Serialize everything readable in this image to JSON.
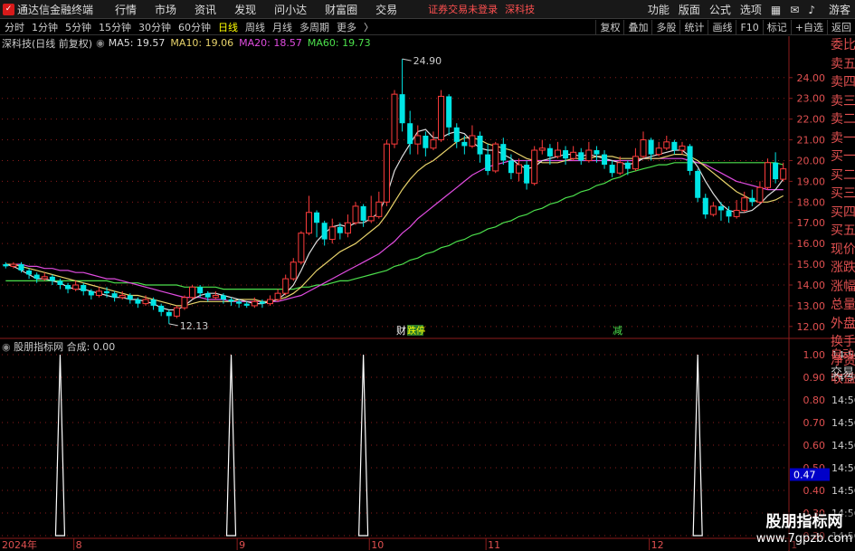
{
  "app": {
    "logo": "logo-icon",
    "title": "通达信金融终端",
    "menu": [
      "行情",
      "市场",
      "资讯",
      "发现",
      "问小达",
      "财富圈",
      "交易"
    ],
    "notice": "证券交易未登录",
    "stock": "深科技",
    "right_menu": [
      "功能",
      "版面",
      "公式",
      "选项"
    ],
    "guest": "游客"
  },
  "toolbar": {
    "periods": [
      "分时",
      "1分钟",
      "5分钟",
      "15分钟",
      "30分钟",
      "60分钟",
      "日线",
      "周线",
      "月线",
      "多周期",
      "更多"
    ],
    "active": "日线",
    "tools": [
      "复权",
      "叠加",
      "多股",
      "统计",
      "画线",
      "F10",
      "标记",
      "+自选",
      "返回"
    ]
  },
  "legend": {
    "name": "深科技(日线 前复权)",
    "ma5": "MA5: 19.57",
    "ma10": "MA10: 19.06",
    "ma20": "MA20: 18.57",
    "ma60": "MA60: 19.73"
  },
  "sidepanel": [
    "委比",
    "卖五",
    "卖四",
    "卖三",
    "卖二",
    "卖一",
    "买一",
    "买二",
    "买三",
    "买四",
    "买五",
    "现价",
    "涨跌",
    "涨幅",
    "总量",
    "外盘",
    "换手",
    "净资",
    "收益"
  ],
  "sub": {
    "name": "股朋指标网",
    "value": "合成: 0.00",
    "side": [
      "自动",
      "交易"
    ],
    "times": [
      "14:56",
      "14:56",
      "14:56",
      "14:56",
      "14:56",
      "14:56",
      "14:56",
      "14:56",
      "14:56"
    ]
  },
  "markers": {
    "cai": "财",
    "dieting": "跌停",
    "jian": "减"
  },
  "watermark": {
    "line1": "股朋指标网",
    "line2": "www.7gpzb.com"
  },
  "colors": {
    "up": "#ff3c3c",
    "down": "#00e5e5",
    "ma5": "#dddddd",
    "ma10": "#e8d36b",
    "ma20": "#e04ce0",
    "ma60": "#4ce04c",
    "grid": "#8b1c1c"
  },
  "chart_data": {
    "type": "candlestick",
    "price_axis": [
      24.0,
      23.0,
      22.0,
      21.0,
      20.0,
      19.0,
      18.0,
      17.0,
      16.0,
      15.0,
      14.0,
      13.0,
      12.0
    ],
    "ylim": [
      11.6,
      25.3
    ],
    "sub_axis": [
      1.0,
      0.9,
      0.8,
      0.7,
      0.6,
      0.5,
      0.4,
      0.3,
      0.2
    ],
    "sub_current": "0.47",
    "high_label": "24.90",
    "low_label": "12.13",
    "date_labels": [
      "2024年",
      "8",
      "9",
      "10",
      "11",
      "12",
      "1"
    ],
    "x_start_label": "2024年",
    "candles": [
      [
        15.0,
        14.9,
        15.1,
        14.8
      ],
      [
        14.9,
        15.0,
        15.1,
        14.8
      ],
      [
        15.0,
        14.7,
        15.1,
        14.6
      ],
      [
        14.7,
        14.5,
        14.8,
        14.3
      ],
      [
        14.5,
        14.3,
        14.6,
        14.1
      ],
      [
        14.3,
        14.4,
        14.6,
        14.2
      ],
      [
        14.4,
        14.2,
        14.5,
        14.0
      ],
      [
        14.2,
        14.0,
        14.3,
        13.8
      ],
      [
        14.0,
        13.8,
        14.1,
        13.6
      ],
      [
        13.8,
        14.0,
        14.2,
        13.7
      ],
      [
        14.0,
        13.7,
        14.1,
        13.5
      ],
      [
        13.7,
        13.5,
        13.8,
        13.3
      ],
      [
        13.5,
        13.7,
        13.9,
        13.4
      ],
      [
        13.7,
        13.6,
        13.9,
        13.4
      ],
      [
        13.6,
        13.4,
        13.7,
        13.2
      ],
      [
        13.4,
        13.5,
        13.7,
        13.3
      ],
      [
        13.5,
        13.3,
        13.6,
        13.1
      ],
      [
        13.3,
        13.1,
        13.4,
        12.9
      ],
      [
        13.1,
        13.3,
        13.5,
        13.0
      ],
      [
        13.3,
        13.0,
        13.4,
        12.8
      ],
      [
        13.0,
        12.7,
        13.1,
        12.5
      ],
      [
        12.7,
        12.5,
        12.8,
        12.13
      ],
      [
        12.5,
        12.9,
        13.0,
        12.4
      ],
      [
        12.9,
        13.4,
        13.5,
        12.8
      ],
      [
        13.4,
        13.9,
        14.0,
        13.3
      ],
      [
        13.9,
        13.6,
        14.0,
        13.4
      ],
      [
        13.6,
        13.4,
        13.7,
        13.2
      ],
      [
        13.4,
        13.5,
        13.7,
        13.3
      ],
      [
        13.5,
        13.3,
        13.6,
        13.1
      ],
      [
        13.3,
        13.2,
        13.4,
        13.0
      ],
      [
        13.2,
        13.1,
        13.3,
        12.9
      ],
      [
        13.1,
        13.0,
        13.2,
        12.9
      ],
      [
        13.0,
        13.2,
        13.4,
        12.9
      ],
      [
        13.2,
        13.1,
        13.3,
        12.9
      ],
      [
        13.1,
        13.3,
        13.5,
        13.0
      ],
      [
        13.3,
        13.6,
        13.8,
        13.2
      ],
      [
        13.6,
        14.3,
        14.5,
        13.5
      ],
      [
        14.3,
        15.1,
        15.3,
        14.2
      ],
      [
        15.1,
        16.5,
        16.6,
        15.0
      ],
      [
        16.5,
        17.5,
        18.3,
        16.4
      ],
      [
        17.5,
        17.0,
        17.6,
        16.3
      ],
      [
        17.0,
        16.2,
        17.1,
        15.9
      ],
      [
        16.2,
        16.8,
        17.2,
        16.0
      ],
      [
        16.8,
        16.5,
        17.0,
        16.2
      ],
      [
        16.5,
        17.0,
        17.4,
        16.3
      ],
      [
        17.0,
        17.8,
        18.0,
        16.9
      ],
      [
        17.8,
        17.1,
        17.9,
        16.8
      ],
      [
        17.1,
        17.3,
        18.3,
        17.0
      ],
      [
        17.3,
        18.0,
        18.5,
        17.2
      ],
      [
        18.0,
        20.8,
        21.0,
        17.8
      ],
      [
        20.8,
        23.2,
        23.4,
        20.6
      ],
      [
        23.2,
        21.8,
        24.9,
        21.4
      ],
      [
        21.8,
        20.8,
        22.4,
        20.3
      ],
      [
        20.8,
        21.2,
        21.7,
        20.3
      ],
      [
        21.2,
        20.6,
        21.4,
        20.2
      ],
      [
        20.6,
        21.0,
        21.4,
        20.5
      ],
      [
        21.0,
        23.1,
        23.4,
        20.9
      ],
      [
        23.1,
        21.6,
        23.2,
        21.2
      ],
      [
        21.6,
        20.9,
        21.8,
        20.6
      ],
      [
        20.9,
        20.7,
        21.2,
        20.3
      ],
      [
        20.7,
        21.2,
        21.7,
        20.6
      ],
      [
        21.2,
        20.3,
        21.4,
        19.9
      ],
      [
        20.3,
        19.5,
        20.8,
        19.3
      ],
      [
        19.5,
        20.8,
        20.9,
        19.4
      ],
      [
        20.8,
        20.0,
        21.1,
        19.8
      ],
      [
        20.0,
        19.4,
        20.3,
        19.1
      ],
      [
        19.4,
        19.8,
        20.1,
        19.0
      ],
      [
        19.8,
        18.9,
        20.0,
        18.6
      ],
      [
        18.9,
        20.5,
        20.7,
        18.8
      ],
      [
        20.5,
        20.6,
        21.0,
        20.3
      ],
      [
        20.6,
        20.2,
        20.8,
        19.8
      ],
      [
        20.2,
        20.5,
        20.9,
        20.1
      ],
      [
        20.5,
        20.1,
        20.7,
        19.8
      ],
      [
        20.1,
        20.4,
        20.7,
        20.0
      ],
      [
        20.4,
        20.0,
        20.6,
        19.8
      ],
      [
        20.0,
        20.5,
        20.9,
        19.9
      ],
      [
        20.5,
        20.3,
        20.7,
        19.9
      ],
      [
        20.3,
        19.8,
        20.5,
        19.6
      ],
      [
        19.8,
        19.4,
        20.0,
        19.2
      ],
      [
        19.4,
        19.9,
        20.2,
        19.3
      ],
      [
        19.9,
        19.6,
        20.0,
        19.3
      ],
      [
        19.6,
        20.2,
        20.6,
        19.5
      ],
      [
        20.2,
        21.0,
        21.4,
        20.1
      ],
      [
        21.0,
        20.3,
        21.1,
        20.0
      ],
      [
        20.3,
        20.6,
        20.9,
        20.2
      ],
      [
        20.6,
        20.9,
        21.2,
        20.5
      ],
      [
        20.9,
        20.5,
        21.0,
        20.3
      ],
      [
        20.5,
        20.7,
        20.9,
        20.3
      ],
      [
        20.7,
        19.5,
        20.8,
        19.3
      ],
      [
        19.5,
        18.2,
        19.6,
        18.0
      ],
      [
        18.2,
        17.4,
        18.4,
        17.2
      ],
      [
        17.4,
        17.8,
        18.0,
        17.3
      ],
      [
        17.8,
        17.6,
        18.0,
        17.1
      ],
      [
        17.6,
        17.3,
        17.8,
        17.0
      ],
      [
        17.3,
        17.6,
        18.1,
        17.2
      ],
      [
        17.6,
        18.2,
        18.5,
        17.5
      ],
      [
        18.2,
        18.0,
        18.6,
        17.8
      ],
      [
        18.0,
        18.7,
        19.0,
        17.9
      ],
      [
        18.7,
        19.9,
        20.1,
        18.6
      ],
      [
        19.9,
        19.1,
        20.4,
        18.9
      ],
      [
        19.1,
        19.6,
        19.9,
        19.0
      ]
    ],
    "ma5": [
      15.0,
      14.9,
      14.7,
      14.5,
      14.3,
      14.3,
      14.2,
      14.1,
      13.9,
      13.8,
      13.8,
      13.7,
      13.6,
      13.5,
      13.4,
      13.4,
      13.3,
      13.3,
      13.2,
      13.1,
      12.9,
      12.8,
      12.8,
      13.0,
      13.3,
      13.5,
      13.6,
      13.6,
      13.5,
      13.4,
      13.3,
      13.2,
      13.1,
      13.1,
      13.2,
      13.3,
      13.6,
      14.0,
      14.7,
      15.5,
      16.1,
      16.5,
      16.8,
      16.9,
      16.8,
      17.0,
      17.0,
      17.2,
      17.5,
      18.3,
      19.5,
      20.2,
      20.8,
      21.4,
      21.5,
      21.1,
      21.1,
      21.3,
      21.4,
      21.3,
      20.9,
      20.6,
      20.5,
      20.5,
      20.3,
      20.1,
      19.8,
      19.6,
      19.7,
      20.0,
      20.1,
      20.2,
      20.3,
      20.3,
      20.2,
      20.3,
      20.2,
      20.1,
      20.0,
      19.9,
      19.8,
      19.9,
      20.1,
      20.2,
      20.3,
      20.4,
      20.5,
      20.5,
      20.2,
      19.7,
      19.0,
      18.4,
      17.9,
      17.6,
      17.5,
      17.5,
      17.6,
      17.9,
      18.3,
      18.6,
      19.1
    ],
    "ma10": [
      15.0,
      15.0,
      14.9,
      14.8,
      14.7,
      14.6,
      14.5,
      14.4,
      14.3,
      14.2,
      14.1,
      14.0,
      13.9,
      13.8,
      13.7,
      13.6,
      13.5,
      13.5,
      13.4,
      13.3,
      13.2,
      13.1,
      13.0,
      13.0,
      13.1,
      13.2,
      13.2,
      13.2,
      13.2,
      13.2,
      13.3,
      13.3,
      13.3,
      13.2,
      13.2,
      13.3,
      13.4,
      13.6,
      13.9,
      14.3,
      14.7,
      15.0,
      15.3,
      15.6,
      15.8,
      16.0,
      16.3,
      16.6,
      16.9,
      17.4,
      18.0,
      18.6,
      19.1,
      19.5,
      19.8,
      20.0,
      20.3,
      20.6,
      20.9,
      21.1,
      21.1,
      21.0,
      20.8,
      20.7,
      20.6,
      20.5,
      20.3,
      20.1,
      20.0,
      19.9,
      19.9,
      19.9,
      20.0,
      20.1,
      20.1,
      20.1,
      20.2,
      20.2,
      20.2,
      20.1,
      20.1,
      20.1,
      20.1,
      20.1,
      20.1,
      20.2,
      20.3,
      20.3,
      20.2,
      20.0,
      19.7,
      19.4,
      19.1,
      18.8,
      18.5,
      18.3,
      18.1,
      18.0,
      18.0,
      18.1,
      18.3
    ],
    "ma20": [
      15.0,
      15.0,
      15.0,
      14.9,
      14.9,
      14.8,
      14.8,
      14.7,
      14.7,
      14.6,
      14.6,
      14.5,
      14.4,
      14.3,
      14.3,
      14.2,
      14.1,
      14.0,
      13.9,
      13.8,
      13.7,
      13.6,
      13.5,
      13.4,
      13.4,
      13.4,
      13.3,
      13.3,
      13.3,
      13.2,
      13.2,
      13.2,
      13.2,
      13.2,
      13.2,
      13.2,
      13.3,
      13.4,
      13.5,
      13.7,
      13.9,
      14.1,
      14.3,
      14.5,
      14.7,
      14.9,
      15.1,
      15.3,
      15.5,
      15.8,
      16.1,
      16.5,
      16.8,
      17.2,
      17.5,
      17.8,
      18.1,
      18.4,
      18.7,
      19.0,
      19.3,
      19.5,
      19.7,
      19.8,
      19.9,
      20.0,
      20.0,
      20.0,
      20.0,
      20.0,
      20.0,
      20.0,
      20.0,
      20.0,
      20.0,
      20.0,
      20.0,
      20.0,
      20.0,
      20.0,
      20.0,
      20.0,
      20.1,
      20.1,
      20.1,
      20.1,
      20.1,
      20.1,
      20.0,
      19.9,
      19.8,
      19.6,
      19.4,
      19.2,
      19.0,
      18.9,
      18.8,
      18.7,
      18.6,
      18.6,
      18.6
    ],
    "ma60": [
      14.2,
      14.2,
      14.2,
      14.2,
      14.2,
      14.2,
      14.2,
      14.2,
      14.2,
      14.2,
      14.2,
      14.2,
      14.2,
      14.2,
      14.1,
      14.1,
      14.1,
      14.1,
      14.0,
      14.0,
      14.0,
      14.0,
      14.0,
      13.9,
      13.9,
      13.9,
      13.9,
      13.9,
      13.8,
      13.8,
      13.8,
      13.8,
      13.8,
      13.8,
      13.8,
      13.8,
      13.8,
      13.8,
      13.9,
      13.9,
      14.0,
      14.0,
      14.1,
      14.2,
      14.2,
      14.3,
      14.4,
      14.5,
      14.6,
      14.7,
      14.9,
      15.0,
      15.2,
      15.3,
      15.5,
      15.6,
      15.8,
      15.9,
      16.1,
      16.2,
      16.4,
      16.5,
      16.7,
      16.8,
      17.0,
      17.1,
      17.3,
      17.4,
      17.6,
      17.7,
      17.9,
      18.0,
      18.2,
      18.3,
      18.5,
      18.6,
      18.8,
      18.9,
      19.1,
      19.2,
      19.4,
      19.5,
      19.6,
      19.7,
      19.8,
      19.8,
      19.9,
      19.9,
      19.9,
      19.9,
      19.9,
      19.9,
      19.9,
      19.9,
      19.9,
      19.9,
      19.9,
      19.9,
      19.9,
      19.9,
      19.8
    ],
    "spikes": [
      7,
      29,
      46,
      89
    ]
  }
}
